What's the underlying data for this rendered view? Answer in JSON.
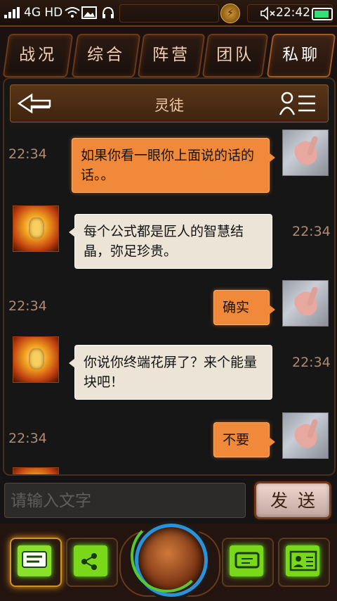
{
  "status_bar": {
    "network": "4G HD",
    "time": "22:42",
    "icons": [
      "signal-icon",
      "wifi-icon",
      "image-icon",
      "headset-icon",
      "mute-icon",
      "battery-icon"
    ]
  },
  "tabs": [
    {
      "label": "战况",
      "active": false
    },
    {
      "label": "综合",
      "active": false
    },
    {
      "label": "阵营",
      "active": false
    },
    {
      "label": "团队",
      "active": false
    },
    {
      "label": "私聊",
      "active": true
    }
  ],
  "chat": {
    "title": "灵徒",
    "messages": [
      {
        "direction": "out",
        "time": "22:34",
        "text": "如果你看一眼你上面说的话的话。。"
      },
      {
        "direction": "in",
        "time": "22:34",
        "text": "每个公式都是匠人的智慧结晶，弥足珍贵。"
      },
      {
        "direction": "out",
        "time": "22:34",
        "text": "确实"
      },
      {
        "direction": "in",
        "time": "22:34",
        "text": "你说你终端花屏了？来个能量块吧！"
      },
      {
        "direction": "out",
        "time": "22:34",
        "text": "不要"
      }
    ]
  },
  "composer": {
    "placeholder": "请输入文字",
    "send_label": "发送"
  },
  "bottom_nav": {
    "items": [
      "chat-icon",
      "share-icon",
      "center-orb",
      "computer-icon",
      "profile-card-icon"
    ],
    "active": "chat-icon"
  }
}
